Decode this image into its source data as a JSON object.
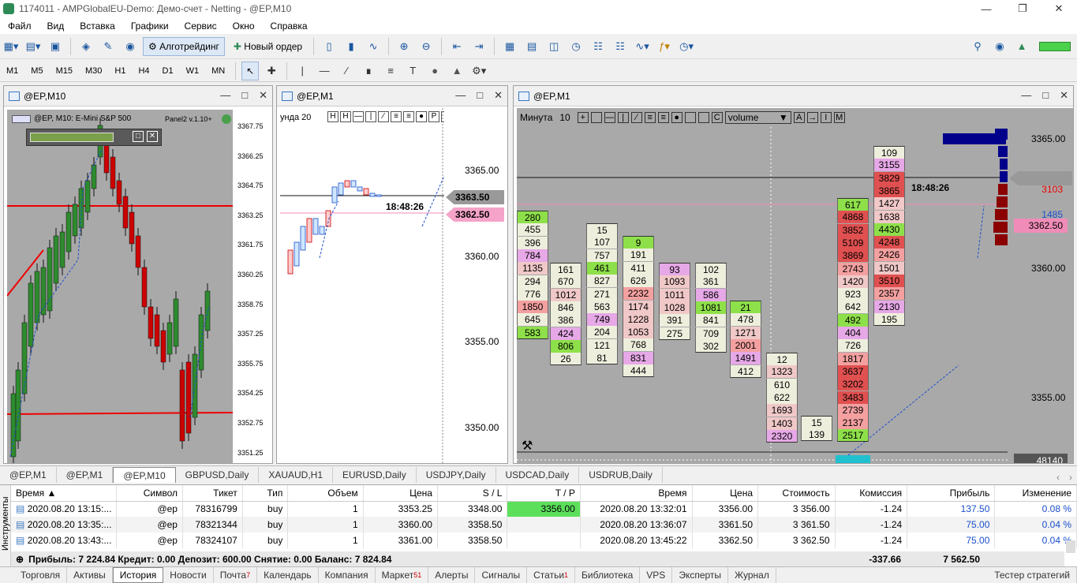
{
  "window": {
    "title": "1174011 - AMPGlobalEU-Demo: Демо-счет - Netting - @EP,M10"
  },
  "menu": [
    "Файл",
    "Вид",
    "Вставка",
    "Графики",
    "Сервис",
    "Окно",
    "Справка"
  ],
  "toolbar": {
    "algo_label": "Алготрейдинг",
    "order_label": "Новый ордер"
  },
  "timeframes": [
    "M1",
    "M5",
    "M15",
    "M30",
    "H1",
    "H4",
    "D1",
    "W1",
    "MN"
  ],
  "charts": [
    {
      "title": "@EP,M10",
      "legend": "@EP, M10:  E-Mini S&P 500",
      "panel": "Panel2 v.1.10+",
      "ticks": [
        "3367.75",
        "3366.25",
        "3364.75",
        "3363.25",
        "3361.75",
        "3360.25",
        "3358.75",
        "3357.25",
        "3355.75",
        "3354.25",
        "3352.75",
        "3351.25"
      ]
    },
    {
      "title": "@EP,M1",
      "timer_label": "унда  20",
      "time": "18:48:26",
      "price_gray": "3363.50",
      "price_pink": "3362.50",
      "ticks": [
        "3365.00",
        "3360.00",
        "3355.00",
        "3350.00"
      ]
    },
    {
      "title": "@EP,M1",
      "timeframe_label": "Минута",
      "period": "10",
      "mode": "volume",
      "time": "18:48:26",
      "vol_red": "3103",
      "vol_blue": "1485",
      "price_pink": "3362.50",
      "bottom_value": "48140",
      "ticks": [
        "3365.00",
        "3360.00",
        "3355.00"
      ]
    }
  ],
  "footprint": [
    [
      "280",
      "455",
      "396",
      "784",
      "1135",
      "294",
      "776",
      "1850",
      "645",
      "583"
    ],
    [
      "161",
      "670",
      "1012",
      "846",
      "386",
      "424",
      "806",
      "26"
    ],
    [
      "15",
      "107",
      "757",
      "461",
      "827",
      "271",
      "563",
      "749",
      "204",
      "121",
      "81"
    ],
    [
      "9",
      "191",
      "411",
      "626",
      "2232",
      "1174",
      "1228",
      "1053",
      "768",
      "831",
      "444"
    ],
    [
      "93",
      "1093",
      "1011",
      "1028",
      "391",
      "275"
    ],
    [
      "102",
      "361",
      "586",
      "1081",
      "841",
      "709",
      "302"
    ],
    [
      "21",
      "478",
      "1271",
      "2001",
      "1491",
      "412"
    ],
    [
      "12",
      "1323",
      "610",
      "622",
      "1693",
      "1403",
      "2320"
    ],
    [
      "15",
      "139"
    ],
    [
      "617",
      "4868",
      "3852",
      "5109",
      "3869",
      "2743",
      "1420",
      "923",
      "642",
      "492",
      "404",
      "726",
      "1817",
      "3637",
      "3202",
      "3483",
      "2739",
      "2137",
      "2517"
    ],
    [
      "109",
      "3155",
      "3829",
      "3865",
      "1427",
      "1638",
      "4430",
      "4248",
      "2426",
      "1501",
      "3510",
      "2357",
      "2130",
      "195"
    ]
  ],
  "chart_tabs": [
    "@EP,M1",
    "@EP,M1",
    "@EP,M10",
    "GBPUSD,Daily",
    "XAUAUD,H1",
    "EURUSD,Daily",
    "USDJPY,Daily",
    "USDCAD,Daily",
    "USDRUB,Daily"
  ],
  "toolbox": {
    "side_label": "Инструменты",
    "columns": [
      "Время",
      "Символ",
      "Тикет",
      "Тип",
      "Объем",
      "Цена",
      "S / L",
      "T / P",
      "Время",
      "Цена",
      "Стоимость",
      "Комиссия",
      "Прибыль",
      "Изменение"
    ],
    "rows": [
      [
        "2020.08.20 13:15:...",
        "@ep",
        "78316799",
        "buy",
        "1",
        "3353.25",
        "3348.00",
        "3356.00",
        "2020.08.20 13:32:01",
        "3356.00",
        "3 356.00",
        "-1.24",
        "137.50",
        "0.08 %"
      ],
      [
        "2020.08.20 13:35:...",
        "@ep",
        "78321344",
        "buy",
        "1",
        "3360.00",
        "3358.50",
        "",
        "2020.08.20 13:36:07",
        "3361.50",
        "3 361.50",
        "-1.24",
        "75.00",
        "0.04 %"
      ],
      [
        "2020.08.20 13:43:...",
        "@ep",
        "78324107",
        "buy",
        "1",
        "3361.00",
        "3358.50",
        "",
        "2020.08.20 13:45:22",
        "3362.50",
        "3 362.50",
        "-1.24",
        "75.00",
        "0.04 %"
      ]
    ],
    "summary": "Прибыль: 7 224.84  Кредит: 0.00  Депозит: 600.00  Снятие: 0.00  Баланс: 7 824.84",
    "summary_commission": "-337.66",
    "summary_profit": "7 562.50"
  },
  "bottom_tabs": [
    {
      "label": "Торговля",
      "badge": ""
    },
    {
      "label": "Активы",
      "badge": ""
    },
    {
      "label": "История",
      "badge": ""
    },
    {
      "label": "Новости",
      "badge": ""
    },
    {
      "label": "Почта",
      "badge": "7"
    },
    {
      "label": "Календарь",
      "badge": ""
    },
    {
      "label": "Компания",
      "badge": ""
    },
    {
      "label": "Маркет",
      "badge": "51"
    },
    {
      "label": "Алерты",
      "badge": ""
    },
    {
      "label": "Сигналы",
      "badge": ""
    },
    {
      "label": "Статьи",
      "badge": "1"
    },
    {
      "label": "Библиотека",
      "badge": ""
    },
    {
      "label": "VPS",
      "badge": ""
    },
    {
      "label": "Эксперты",
      "badge": ""
    },
    {
      "label": "Журнал",
      "badge": ""
    }
  ],
  "strategy_tester": "Тестер стратегий"
}
